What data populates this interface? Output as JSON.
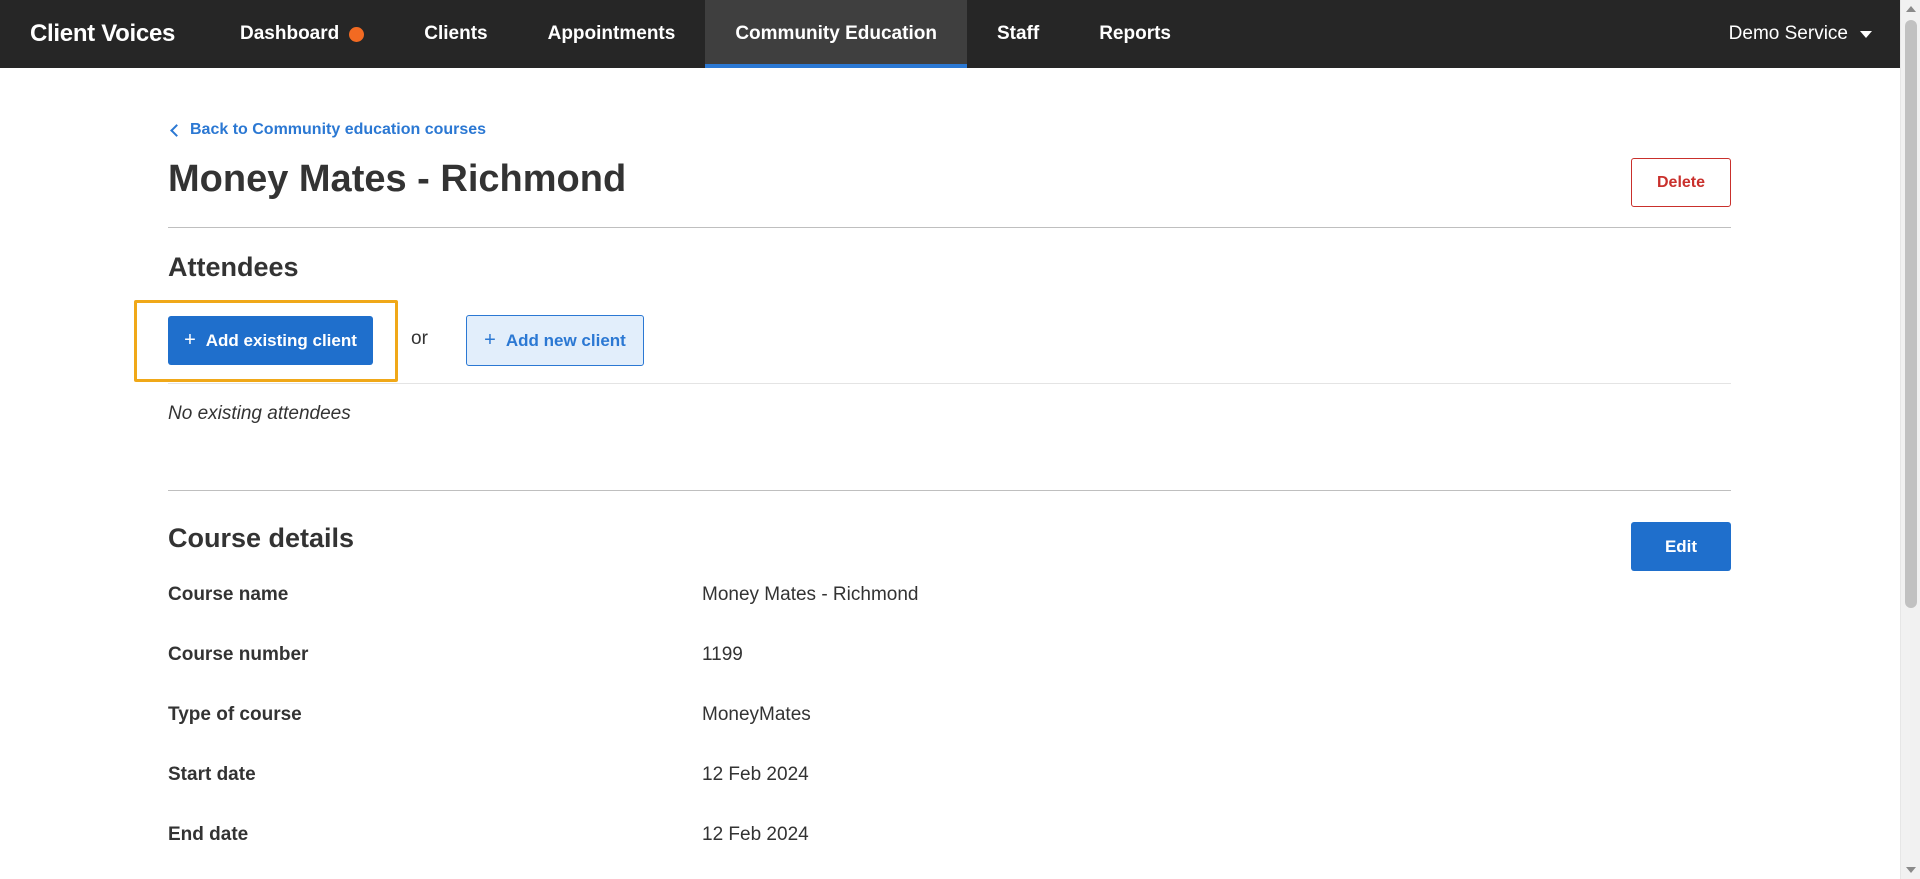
{
  "app": {
    "brand": "Client Voices"
  },
  "nav": {
    "items": [
      {
        "label": "Dashboard"
      },
      {
        "label": "Clients"
      },
      {
        "label": "Appointments"
      },
      {
        "label": "Community Education"
      },
      {
        "label": "Staff"
      },
      {
        "label": "Reports"
      }
    ],
    "active": "Community Education",
    "account_label": "Demo Service"
  },
  "page": {
    "back_link": "Back to Community education courses",
    "title": "Money Mates - Richmond",
    "delete_label": "Delete"
  },
  "attendees": {
    "heading": "Attendees",
    "add_existing_label": "Add existing client",
    "or_text": "or",
    "add_new_label": "Add new client",
    "empty_text": "No existing attendees"
  },
  "course_details": {
    "heading": "Course details",
    "edit_label": "Edit",
    "rows": [
      {
        "label": "Course name",
        "value": "Money Mates - Richmond"
      },
      {
        "label": "Course number",
        "value": "1199"
      },
      {
        "label": "Type of course",
        "value": "MoneyMates"
      },
      {
        "label": "Start date",
        "value": "12 Feb 2024"
      },
      {
        "label": "End date",
        "value": "12 Feb 2024"
      }
    ]
  },
  "colors": {
    "nav_bg": "#262626",
    "accent": "#1f6fcc",
    "notification_dot": "#f26a22",
    "danger": "#c9302c",
    "highlight": "#f0a818"
  }
}
